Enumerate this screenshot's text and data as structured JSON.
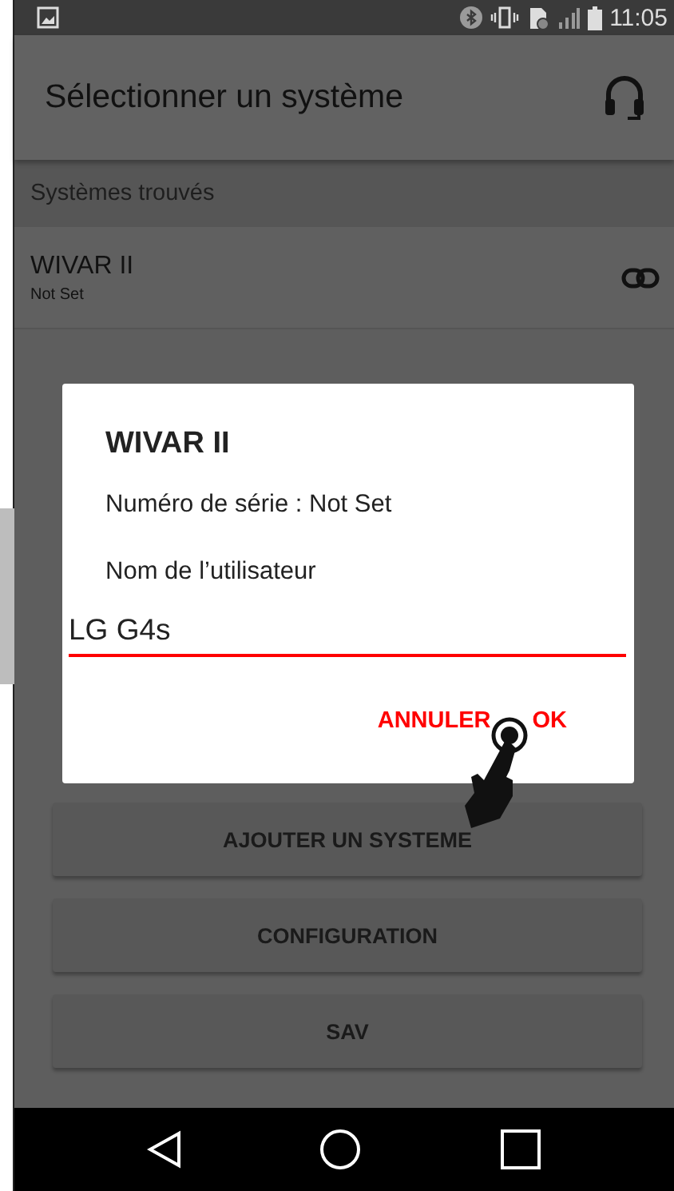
{
  "status_bar": {
    "time": "11:05"
  },
  "app_bar": {
    "title": "Sélectionner un système"
  },
  "section_header": "Systèmes trouvés",
  "systems": [
    {
      "name": "WIVAR II",
      "serial": "Not Set"
    }
  ],
  "buttons": [
    "AJOUTER UN SYSTEME",
    "CONFIGURATION",
    "SAV"
  ],
  "dialog": {
    "title": "WIVAR II",
    "serial_line": "Numéro de série : Not Set",
    "field_label": "Nom de l’utilisateur",
    "field_value": "LG G4s",
    "actions": [
      "ANNULER",
      "OK"
    ]
  }
}
